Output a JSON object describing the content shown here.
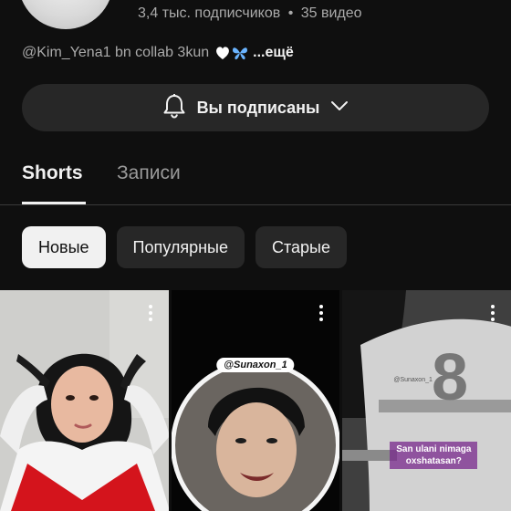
{
  "channel": {
    "subscribers": "3,4 тыс. подписчиков",
    "separator": "•",
    "videos": "35 видео",
    "description": "@Kim_Yena1 bn collab 3kun",
    "more": "...ещё"
  },
  "subscribe": {
    "label": "Вы подписаны",
    "icon": "bell-icon",
    "dropdown_icon": "chevron-down-icon"
  },
  "tabs": [
    {
      "label": "Shorts",
      "active": true
    },
    {
      "label": "Записи",
      "active": false
    }
  ],
  "filters": [
    {
      "label": "Новые",
      "active": true
    },
    {
      "label": "Популярные",
      "active": false
    },
    {
      "label": "Старые",
      "active": false
    }
  ],
  "shorts": [
    {
      "id": "short-1"
    },
    {
      "id": "short-2",
      "tag": "@Sunaxon_1"
    },
    {
      "id": "short-3",
      "handle": "@Sunaxon_1",
      "caption": "San ulani nimaga oxshatasan?"
    }
  ],
  "colors": {
    "background": "#0f0f0f",
    "button_bg": "#272727",
    "active_chip": "#f1f1f1",
    "secondary_text": "#aaaaaa"
  }
}
